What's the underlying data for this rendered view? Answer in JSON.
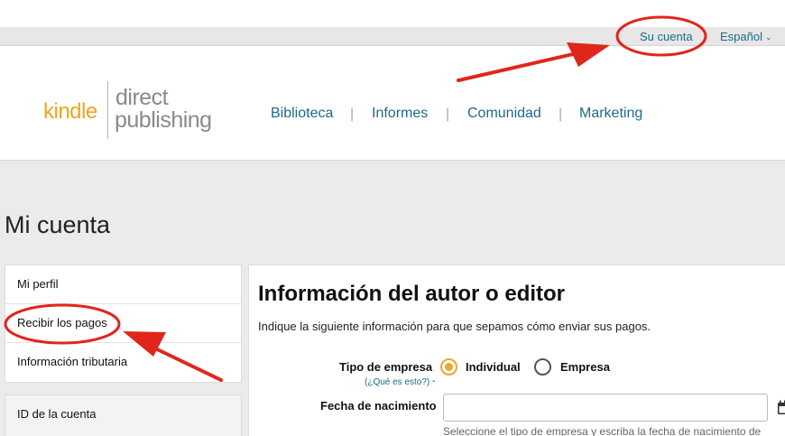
{
  "topbar": {
    "account": "Su cuenta",
    "language": "Español"
  },
  "logo": {
    "kindle": "kindle",
    "direct": "direct",
    "publishing": "publishing"
  },
  "nav": [
    "Biblioteca",
    "Informes",
    "Comunidad",
    "Marketing"
  ],
  "page_title": "Mi cuenta",
  "sidebar": {
    "items": [
      "Mi perfil",
      "Recibir los pagos",
      "Información tributaria"
    ],
    "items2": [
      "ID de la cuenta"
    ]
  },
  "main": {
    "title": "Información del autor o editor",
    "description": "Indique la siguiente información para que sepamos cómo enviar sus pagos.",
    "business_type_label": "Tipo de empresa",
    "help_link": "(¿Qué es esto?)",
    "options": [
      "Individual",
      "Empresa"
    ],
    "selected_option": "Individual",
    "birthdate_label": "Fecha de nacimiento",
    "birthdate_value": "",
    "hint": "Seleccione el tipo de empresa y escriba la fecha de nacimiento de"
  },
  "colors": {
    "link": "#1c6a8b",
    "brand_orange": "#f0a41e",
    "annotation_red": "#e0261b"
  }
}
